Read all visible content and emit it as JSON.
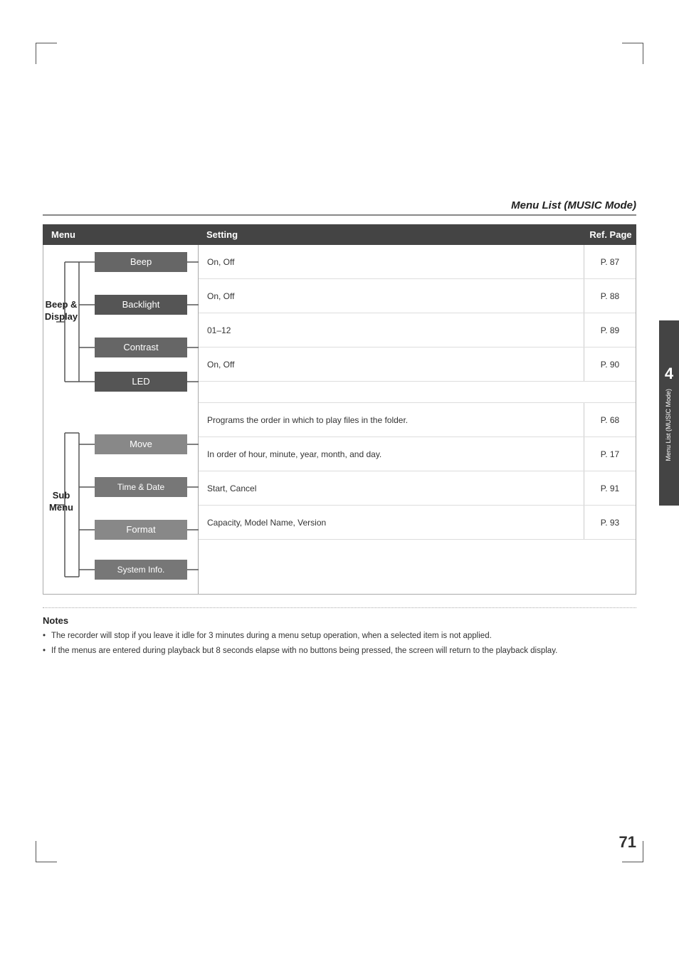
{
  "page": {
    "title": "Menu List (MUSIC Mode)",
    "number": "71",
    "side_tab_number": "4",
    "side_tab_text": "Menu List (MUSIC Mode)"
  },
  "table": {
    "headers": {
      "menu": "Menu",
      "setting": "Setting",
      "ref_page": "Ref. Page"
    },
    "groups": [
      {
        "label": "Beep &\nDisplay",
        "items": [
          {
            "name": "Beep",
            "setting": "On, Off",
            "ref": "P. 87"
          },
          {
            "name": "Backlight",
            "setting": "On, Off",
            "ref": "P. 88"
          },
          {
            "name": "Contrast",
            "setting": "01–12",
            "ref": "P. 89"
          },
          {
            "name": "LED",
            "setting": "On, Off",
            "ref": "P. 90"
          }
        ]
      },
      {
        "label": "Sub\nMenu",
        "items": [
          {
            "name": "Move",
            "setting": "Programs the order in which to play files in the folder.",
            "ref": "P. 68"
          },
          {
            "name": "Time & Date",
            "setting": "In order of hour, minute, year, month, and day.",
            "ref": "P. 17"
          },
          {
            "name": "Format",
            "setting": "Start, Cancel",
            "ref": "P. 91"
          },
          {
            "name": "System Info.",
            "setting": "Capacity, Model Name, Version",
            "ref": "P. 93"
          }
        ]
      }
    ]
  },
  "notes": {
    "title": "Notes",
    "items": [
      "The recorder will stop if you leave it idle for 3 minutes during a menu setup operation, when a selected item is not applied.",
      "If the menus are entered during playback but 8 seconds elapse with no buttons being pressed, the screen will return to the playback display."
    ]
  }
}
